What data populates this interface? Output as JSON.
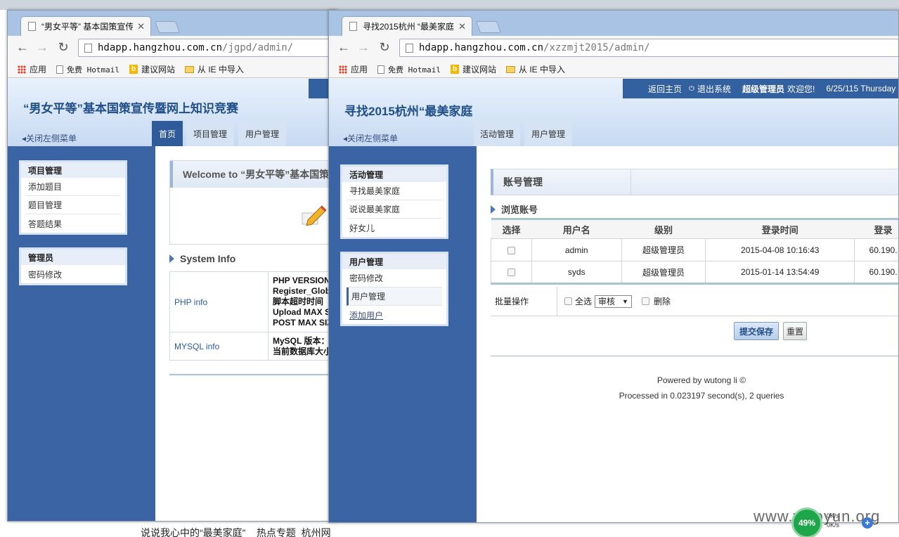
{
  "desktop": {
    "bottom_text": "说说我心中的“最美家庭” _ 热点专题_杭州网"
  },
  "win1": {
    "tab_title": "“男女平等” 基本国策宣传",
    "url_host": "hdapp.hangzhou.com.cn",
    "url_path": "/jgpd/admin/",
    "bookmarks": [
      "应用",
      "免费 Hotmail",
      "建议网站",
      "从 IE 中导入"
    ],
    "site_title": "“男女平等”基本国策宣传暨网上知识竞赛",
    "close_menu": "关闭左侧菜单",
    "nav_tabs": [
      "首页",
      "项目管理",
      "用户管理"
    ],
    "side_groups": [
      {
        "title": "项目管理",
        "items": [
          "添加题目",
          "题目管理",
          "答题结果"
        ]
      },
      {
        "title": "管理员",
        "items": [
          "密码修改"
        ]
      }
    ],
    "welcome": "Welcome to “男女平等”基本国策",
    "system_info_title": "System Info",
    "info_rows": [
      {
        "key": "PHP info",
        "lines": [
          "PHP VERSION",
          "Register_Glob",
          "脚本超时时间",
          "Upload MAX Si",
          "POST MAX SIZ"
        ]
      },
      {
        "key": "MYSQL info",
        "lines": [
          "MySQL 版本：",
          "当前数据库大小"
        ]
      }
    ]
  },
  "win2": {
    "tab_title": "寻找2015杭州 “最美家庭",
    "url_host": "hdapp.hangzhou.com.cn",
    "url_path": "/xzzmjt2015/admin/",
    "bookmarks": [
      "应用",
      "免费 Hotmail",
      "建议网站",
      "从 IE 中导入"
    ],
    "site_title": "寻找2015杭州“最美家庭",
    "header_links": {
      "home": "返回主页",
      "logout": "退出系统",
      "admin": "超级管理员",
      "welcome": "欢迎您!",
      "date": "6/25/115 Thursday"
    },
    "close_menu": "关闭左侧菜单",
    "nav_tabs": [
      "活动管理",
      "用户管理"
    ],
    "side_groups": [
      {
        "title": "活动管理",
        "items": [
          "寻找最美家庭",
          "说说最美家庭",
          "好女儿"
        ]
      },
      {
        "title": "用户管理",
        "items": [
          "密码修改",
          "用户管理",
          "添加用户"
        ]
      }
    ],
    "section_title": "账号管理",
    "browse_title": "浏览账号",
    "table": {
      "headers": [
        "选择",
        "用户名",
        "级别",
        "登录时间",
        "登录"
      ],
      "rows": [
        {
          "user": "admin",
          "level": "超级管理员",
          "time": "2015-04-08 10:16:43",
          "ip": "60.190."
        },
        {
          "user": "syds",
          "level": "超级管理员",
          "time": "2015-01-14 13:54:49",
          "ip": "60.190."
        }
      ]
    },
    "batch": {
      "label": "批量操作",
      "select_all": "全选",
      "action": "审核",
      "delete": "删除"
    },
    "buttons": {
      "submit": "提交保存",
      "reset": "重置"
    },
    "footer": {
      "powered": "Powered by wutong li ©",
      "processed": "Processed in 0.023197 second(s), 2 queries"
    }
  },
  "overlay": {
    "net_percent": "49%",
    "speed_up": "0K/s",
    "speed_down": "0K/s",
    "watermark": "www.wooyun.org"
  }
}
